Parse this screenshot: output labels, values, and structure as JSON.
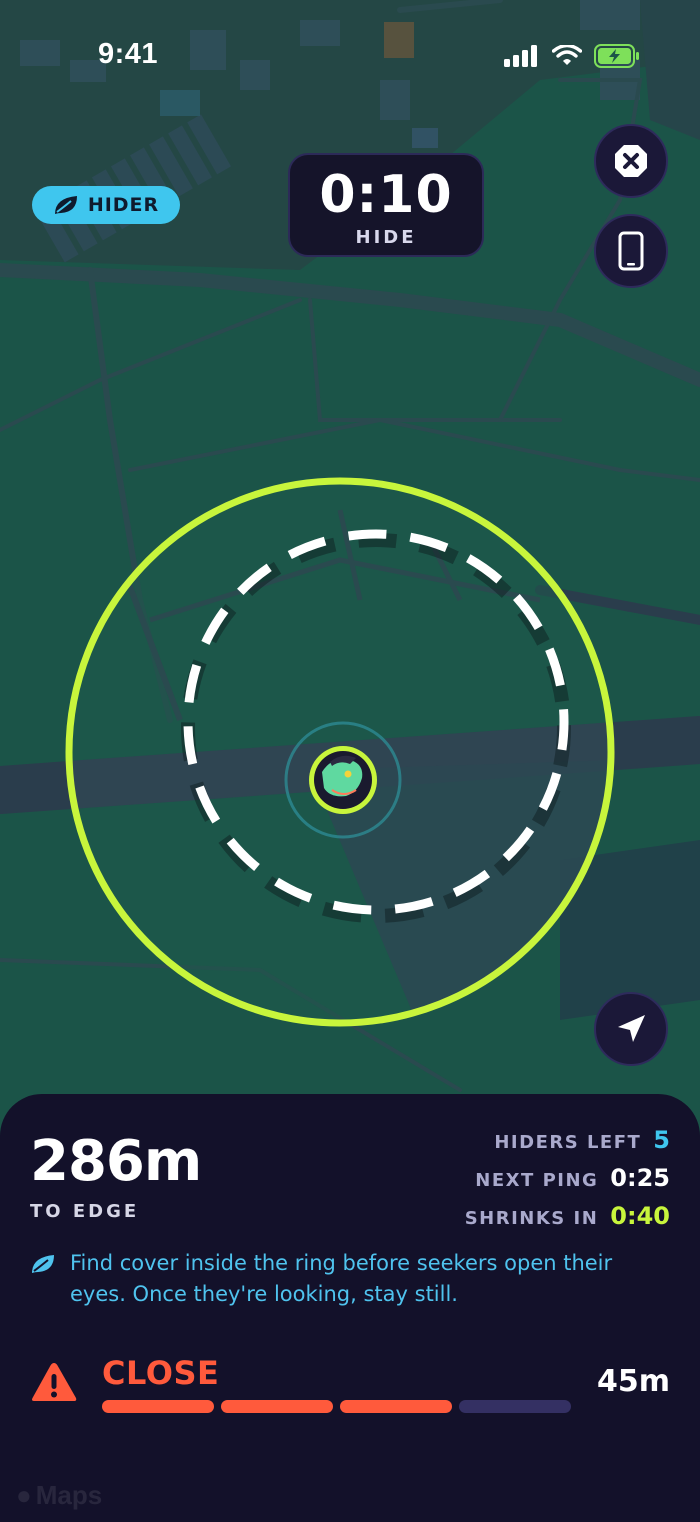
{
  "status_bar": {
    "time": "9:41"
  },
  "role_badge": {
    "label": "HIDER"
  },
  "timer": {
    "value": "0:10",
    "phase": "HIDE"
  },
  "distance": {
    "value": "286m",
    "label": "TO EDGE"
  },
  "stats": [
    {
      "label": "HIDERS LEFT",
      "value": "5",
      "color": "#3fc6ee"
    },
    {
      "label": "NEXT PING",
      "value": "0:25",
      "color": "#ffffff"
    },
    {
      "label": "SHRINKS IN",
      "value": "0:40",
      "color": "#c8f53c"
    }
  ],
  "tip": {
    "text": "Find cover inside the ring before seekers open their eyes. Once they're looking, stay still."
  },
  "proximity": {
    "label": "CLOSE",
    "distance": "45m",
    "level": 3,
    "max_level": 4
  },
  "map_credit": "Maps",
  "icons": {
    "role": "leaf-icon",
    "close_game": "close-icon",
    "device": "phone-icon",
    "recenter": "navigation-arrow-icon",
    "warning": "warning-icon",
    "tip": "leaf-icon"
  },
  "colors": {
    "ring": "#c8f53c",
    "accent": "#3fc6ee",
    "danger": "#ff5a3c",
    "panel": "#13112a"
  }
}
